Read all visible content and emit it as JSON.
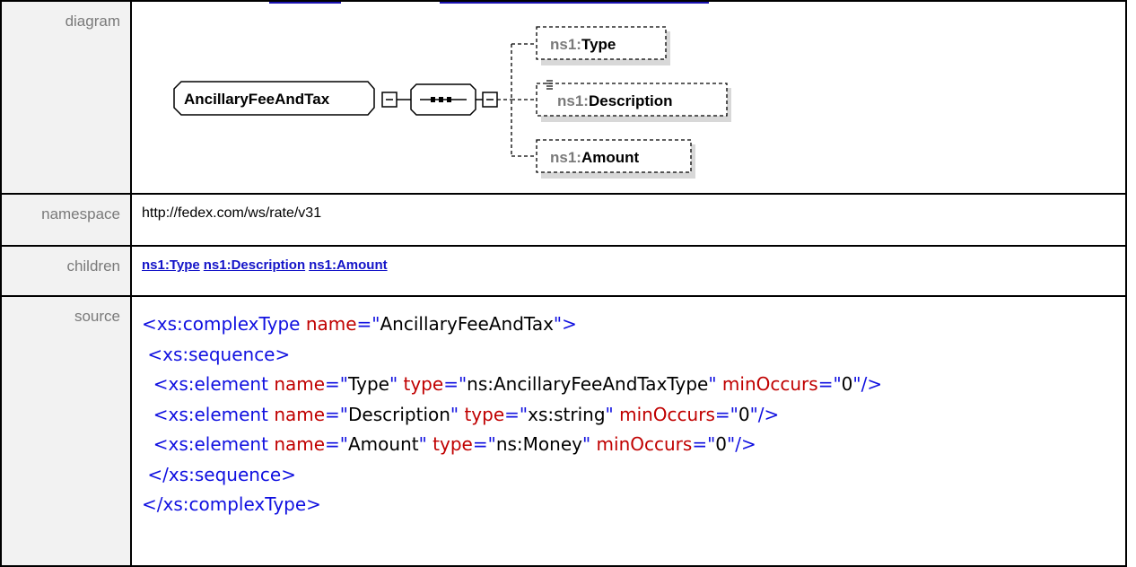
{
  "labels": {
    "diagram": "diagram",
    "namespace": "namespace",
    "children": "children",
    "source": "source"
  },
  "diagram": {
    "main_node": "AncillaryFeeAndTax",
    "elements": [
      {
        "prefix": "ns1:",
        "name": "Type"
      },
      {
        "prefix": "ns1:",
        "name": "Description"
      },
      {
        "prefix": "ns1:",
        "name": "Amount"
      }
    ]
  },
  "namespace": "http://fedex.com/ws/rate/v31",
  "children": [
    "ns1:Type",
    "ns1:Description",
    "ns1:Amount"
  ],
  "source": {
    "l1": {
      "open": "<xs:complexType",
      "attr": "name",
      "eq": "=\"",
      "val": "AncillaryFeeAndTax",
      "end": "\">"
    },
    "l2": "<xs:sequence>",
    "l3": {
      "open": "<xs:element",
      "a1": "name",
      "v1": "Type",
      "a2": "type",
      "v2": "ns:AncillaryFeeAndTaxType",
      "a3": "minOccurs",
      "v3": "0",
      "close": "/>"
    },
    "l4": {
      "open": "<xs:element",
      "a1": "name",
      "v1": "Description",
      "a2": "type",
      "v2": "xs:string",
      "a3": "minOccurs",
      "v3": "0",
      "close": "/>"
    },
    "l5": {
      "open": "<xs:element",
      "a1": "name",
      "v1": "Amount",
      "a2": "type",
      "v2": "ns:Money",
      "a3": "minOccurs",
      "v3": "0",
      "close": "/>"
    },
    "l6": "</xs:sequence>",
    "l7": "</xs:complexType>"
  },
  "colors": {
    "tag": "#1010e0",
    "attr": "#c00000",
    "link": "#1414c8"
  }
}
